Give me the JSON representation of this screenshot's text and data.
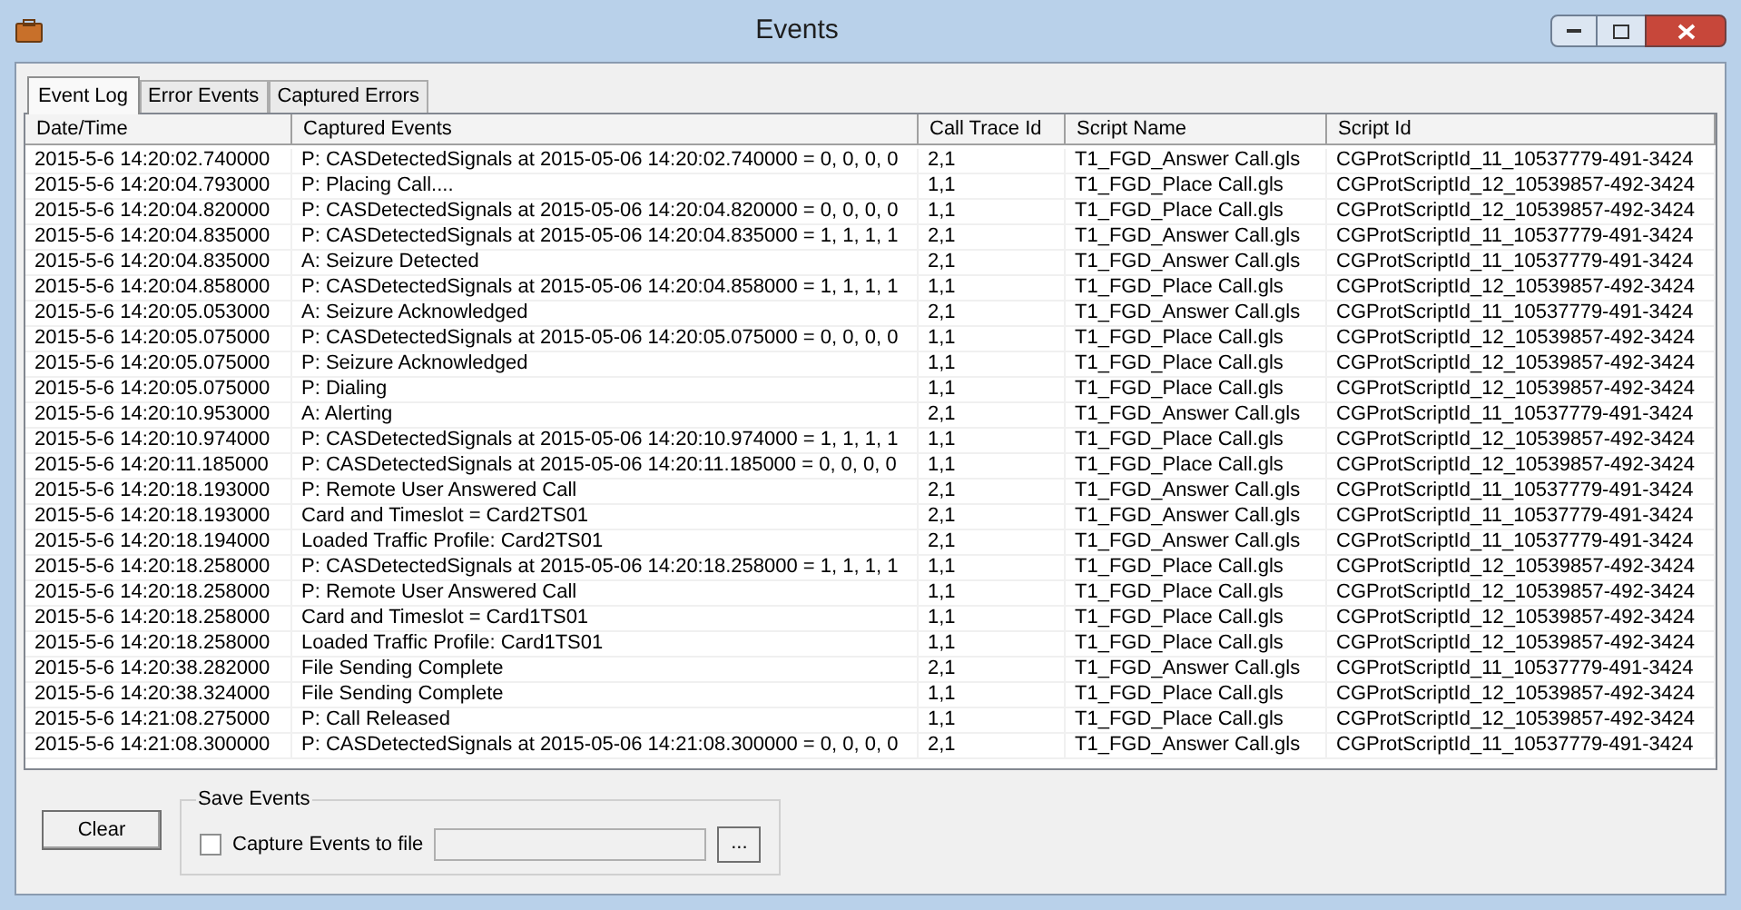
{
  "window": {
    "title": "Events"
  },
  "tabs": [
    {
      "label": "Event Log",
      "selected": true
    },
    {
      "label": "Error Events",
      "selected": false
    },
    {
      "label": "Captured Errors",
      "selected": false
    }
  ],
  "table": {
    "columns": [
      "Date/Time",
      "Captured Events",
      "Call Trace Id",
      "Script Name",
      "Script Id"
    ],
    "rows": [
      [
        "2015-5-6 14:20:02.740000",
        "P: CASDetectedSignals at 2015-05-06 14:20:02.740000 = 0, 0, 0, 0",
        "2,1",
        "T1_FGD_Answer Call.gls",
        "CGProtScriptId_11_10537779-491-3424"
      ],
      [
        "2015-5-6 14:20:04.793000",
        "P: Placing Call....",
        "1,1",
        "T1_FGD_Place Call.gls",
        "CGProtScriptId_12_10539857-492-3424"
      ],
      [
        "2015-5-6 14:20:04.820000",
        "P: CASDetectedSignals at 2015-05-06 14:20:04.820000 = 0, 0, 0, 0",
        "1,1",
        "T1_FGD_Place Call.gls",
        "CGProtScriptId_12_10539857-492-3424"
      ],
      [
        "2015-5-6 14:20:04.835000",
        "P: CASDetectedSignals at 2015-05-06 14:20:04.835000 = 1, 1, 1, 1",
        "2,1",
        "T1_FGD_Answer Call.gls",
        "CGProtScriptId_11_10537779-491-3424"
      ],
      [
        "2015-5-6 14:20:04.835000",
        "A: Seizure Detected",
        "2,1",
        "T1_FGD_Answer Call.gls",
        "CGProtScriptId_11_10537779-491-3424"
      ],
      [
        "2015-5-6 14:20:04.858000",
        "P: CASDetectedSignals at 2015-05-06 14:20:04.858000 = 1, 1, 1, 1",
        "1,1",
        "T1_FGD_Place Call.gls",
        "CGProtScriptId_12_10539857-492-3424"
      ],
      [
        "2015-5-6 14:20:05.053000",
        "A: Seizure Acknowledged",
        "2,1",
        "T1_FGD_Answer Call.gls",
        "CGProtScriptId_11_10537779-491-3424"
      ],
      [
        "2015-5-6 14:20:05.075000",
        "P: CASDetectedSignals at 2015-05-06 14:20:05.075000 = 0, 0, 0, 0",
        "1,1",
        "T1_FGD_Place Call.gls",
        "CGProtScriptId_12_10539857-492-3424"
      ],
      [
        "2015-5-6 14:20:05.075000",
        "P: Seizure Acknowledged",
        "1,1",
        "T1_FGD_Place Call.gls",
        "CGProtScriptId_12_10539857-492-3424"
      ],
      [
        "2015-5-6 14:20:05.075000",
        "P: Dialing",
        "1,1",
        "T1_FGD_Place Call.gls",
        "CGProtScriptId_12_10539857-492-3424"
      ],
      [
        "2015-5-6 14:20:10.953000",
        "A: Alerting",
        "2,1",
        "T1_FGD_Answer Call.gls",
        "CGProtScriptId_11_10537779-491-3424"
      ],
      [
        "2015-5-6 14:20:10.974000",
        "P: CASDetectedSignals at 2015-05-06 14:20:10.974000 = 1, 1, 1, 1",
        "1,1",
        "T1_FGD_Place Call.gls",
        "CGProtScriptId_12_10539857-492-3424"
      ],
      [
        "2015-5-6 14:20:11.185000",
        "P: CASDetectedSignals at 2015-05-06 14:20:11.185000 = 0, 0, 0, 0",
        "1,1",
        "T1_FGD_Place Call.gls",
        "CGProtScriptId_12_10539857-492-3424"
      ],
      [
        "2015-5-6 14:20:18.193000",
        "P: Remote User Answered Call",
        "2,1",
        "T1_FGD_Answer Call.gls",
        "CGProtScriptId_11_10537779-491-3424"
      ],
      [
        "2015-5-6 14:20:18.193000",
        "Card and Timeslot = Card2TS01",
        "2,1",
        "T1_FGD_Answer Call.gls",
        "CGProtScriptId_11_10537779-491-3424"
      ],
      [
        "2015-5-6 14:20:18.194000",
        "Loaded Traffic Profile: Card2TS01",
        "2,1",
        "T1_FGD_Answer Call.gls",
        "CGProtScriptId_11_10537779-491-3424"
      ],
      [
        "2015-5-6 14:20:18.258000",
        "P: CASDetectedSignals at 2015-05-06 14:20:18.258000 = 1, 1, 1, 1",
        "1,1",
        "T1_FGD_Place Call.gls",
        "CGProtScriptId_12_10539857-492-3424"
      ],
      [
        "2015-5-6 14:20:18.258000",
        "P: Remote User Answered Call",
        "1,1",
        "T1_FGD_Place Call.gls",
        "CGProtScriptId_12_10539857-492-3424"
      ],
      [
        "2015-5-6 14:20:18.258000",
        "Card and Timeslot = Card1TS01",
        "1,1",
        "T1_FGD_Place Call.gls",
        "CGProtScriptId_12_10539857-492-3424"
      ],
      [
        "2015-5-6 14:20:18.258000",
        "Loaded Traffic Profile: Card1TS01",
        "1,1",
        "T1_FGD_Place Call.gls",
        "CGProtScriptId_12_10539857-492-3424"
      ],
      [
        "2015-5-6 14:20:38.282000",
        "File Sending Complete",
        "2,1",
        "T1_FGD_Answer Call.gls",
        "CGProtScriptId_11_10537779-491-3424"
      ],
      [
        "2015-5-6 14:20:38.324000",
        "File Sending Complete",
        "1,1",
        "T1_FGD_Place Call.gls",
        "CGProtScriptId_12_10539857-492-3424"
      ],
      [
        "2015-5-6 14:21:08.275000",
        "P: Call Released",
        "1,1",
        "T1_FGD_Place Call.gls",
        "CGProtScriptId_12_10539857-492-3424"
      ],
      [
        "2015-5-6 14:21:08.300000",
        "P: CASDetectedSignals at 2015-05-06 14:21:08.300000 = 0, 0, 0, 0",
        "2,1",
        "T1_FGD_Answer Call.gls",
        "CGProtScriptId_11_10537779-491-3424"
      ]
    ]
  },
  "clear_button": "Clear",
  "save_events": {
    "title": "Save Events",
    "checkbox": {
      "label": "Capture Events to file",
      "checked": false
    },
    "browse_button": "..."
  }
}
